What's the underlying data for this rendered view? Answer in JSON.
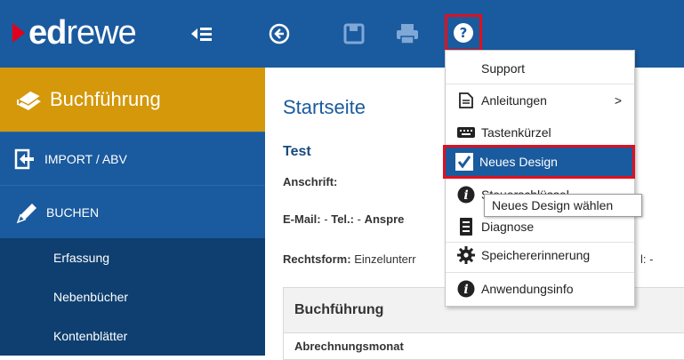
{
  "logo": {
    "ed": "ed",
    "rewe": "rewe"
  },
  "toolbar": {
    "icons": [
      "collapse-menu-icon",
      "back-icon",
      "save-icon",
      "print-icon",
      "help-icon"
    ]
  },
  "sidebar": {
    "title": "Buchführung",
    "items": [
      {
        "label": "IMPORT / ABV",
        "icon": "import-icon"
      },
      {
        "label": "BUCHEN",
        "icon": "pencil-icon"
      }
    ],
    "subitems": [
      "Erfassung",
      "Nebenbücher",
      "Kontenblätter"
    ]
  },
  "main": {
    "title": "Startseite",
    "company": "Test",
    "address_label": "Anschrift:",
    "email_label": "E-Mail:",
    "email_value": "-",
    "tel_label": "Tel.:",
    "tel_value": "-",
    "contact_label_partial": "Anspre",
    "legal_form_label": "Rechtsform:",
    "legal_form_value_partial": "Einzelunterr",
    "obscured_trailing": "l: -",
    "panel_title": "Buchführung",
    "panel_row": "Abrechnungsmonat"
  },
  "help_menu": {
    "items": [
      {
        "label": "Support",
        "icon": ""
      },
      {
        "label": "Anleitungen",
        "icon": "document-icon",
        "submenu": ">"
      },
      {
        "label": "Tastenkürzel",
        "icon": "keyboard-icon"
      },
      {
        "label": "Neues Design",
        "icon": "checkbox-icon",
        "selected": true
      },
      {
        "label": "Steuerschlüssel",
        "icon": "info-icon"
      },
      {
        "label": "Diagnose",
        "icon": "diagnose-icon"
      },
      {
        "label": "Speichererinnerung",
        "icon": "gear-icon"
      },
      {
        "label": "Anwendungsinfo",
        "icon": "info-icon"
      }
    ]
  },
  "tooltip": "Neues Design wählen",
  "colors": {
    "topbar": "#1a5a9e",
    "sidebar_header": "#d4980a",
    "sidebar_sub": "#0e3f70",
    "highlight": "#1a5a9e",
    "red_outline": "#e0101e",
    "logo_red": "#e2001a"
  }
}
